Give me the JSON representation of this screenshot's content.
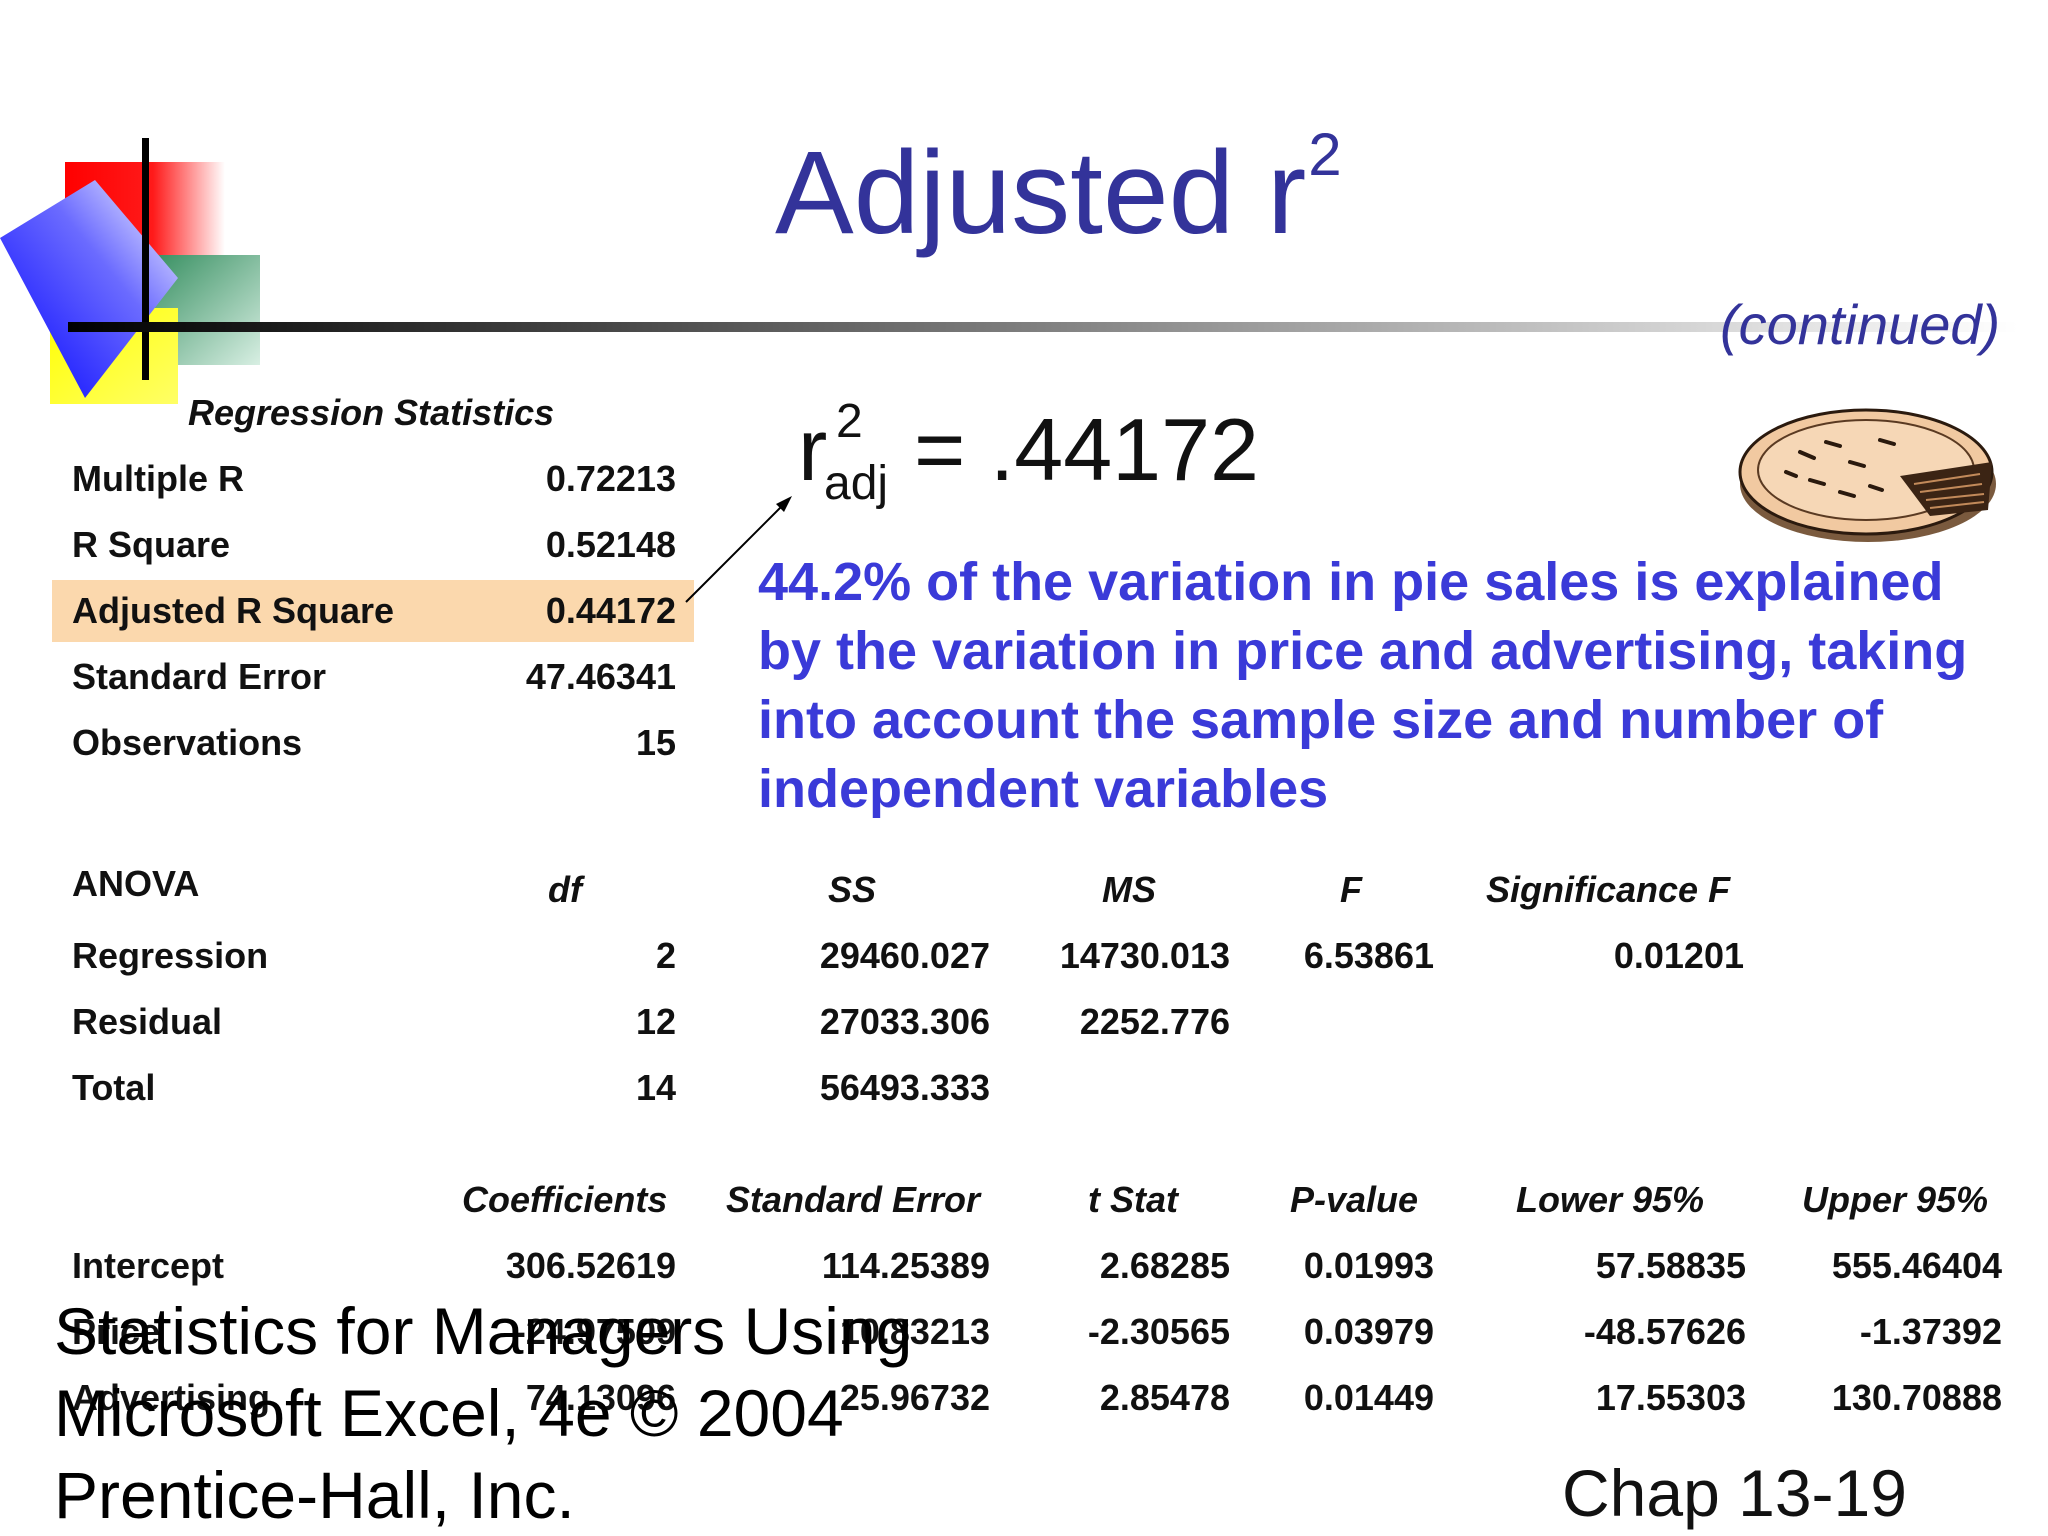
{
  "title": {
    "text": "Adjusted r",
    "superscript": "2"
  },
  "continued": "(continued)",
  "regression_statistics": {
    "heading": "Regression Statistics",
    "rows": [
      {
        "label": "Multiple R",
        "value": "0.72213"
      },
      {
        "label": "R Square",
        "value": "0.52148"
      },
      {
        "label": "Adjusted R Square",
        "value": "0.44172"
      },
      {
        "label": "Standard Error",
        "value": "47.46341"
      },
      {
        "label": "Observations",
        "value": "15"
      }
    ],
    "highlight_color": "#fbd8ad"
  },
  "formula": {
    "symbol": "r",
    "superscript": "2",
    "subscript": "adj",
    "value": "= .44172"
  },
  "explanation": "44.2% of the variation in pie sales is explained by the variation in price and advertising, taking into account the sample size and number of independent variables",
  "anova": {
    "headers": [
      "ANOVA",
      "df",
      "SS",
      "MS",
      "F",
      "Significance F"
    ],
    "rows": [
      [
        "Regression",
        "2",
        "29460.027",
        "14730.013",
        "6.53861",
        "0.01201"
      ],
      [
        "Residual",
        "12",
        "27033.306",
        "2252.776",
        "",
        ""
      ],
      [
        "Total",
        "14",
        "56493.333",
        "",
        "",
        ""
      ]
    ]
  },
  "coefficients": {
    "headers": [
      "",
      "Coefficients",
      "Standard Error",
      "t Stat",
      "P-value",
      "Lower 95%",
      "Upper 95%"
    ],
    "rows": [
      [
        "Intercept",
        "306.52619",
        "114.25389",
        "2.68285",
        "0.01993",
        "57.58835",
        "555.46404"
      ],
      [
        "Price",
        "-24.97509",
        "10.83213",
        "-2.30565",
        "0.03979",
        "-48.57626",
        "-1.37392"
      ],
      [
        "Advertising",
        "74.13096",
        "25.96732",
        "2.85478",
        "0.01449",
        "17.55303",
        "130.70888"
      ]
    ]
  },
  "footer": {
    "left": "Statistics for Managers Using Microsoft Excel, 4e © 2004 Prentice-Hall, Inc.",
    "right": "Chap 13-19"
  },
  "colors": {
    "title": "#33339a",
    "explanation": "#3a3ad8"
  },
  "icons": [
    "logo-squares-icon",
    "pie-icon",
    "arrow-icon"
  ]
}
